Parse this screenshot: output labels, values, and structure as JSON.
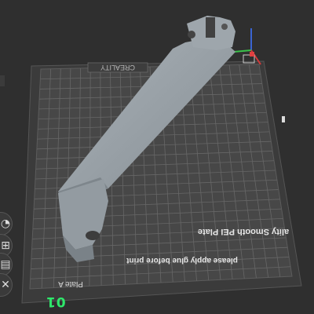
{
  "plate": {
    "brand": "CREALITY",
    "bottom_label": "Plate A",
    "surface_label": "High Quality Smooth PEI Plate",
    "surface_visible": "ality Smooth PEI Plate",
    "note": "please apply glue before print",
    "number": "01"
  },
  "side_toolbar": [
    {
      "name": "orient-icon",
      "glyph": "◔"
    },
    {
      "name": "arrange-icon",
      "glyph": "⊞"
    },
    {
      "name": "layers-icon",
      "glyph": "▤"
    },
    {
      "name": "close-icon",
      "glyph": "✕"
    }
  ],
  "colors": {
    "background": "#2f2f2f",
    "plate": "#4a4a4a",
    "grid": "#6a6a6a",
    "model": "#9aa2a8",
    "plate_number": "#2ee86b",
    "axis_x": "#d23a3a",
    "axis_y": "#3ac24a",
    "axis_z": "#3a64d2"
  }
}
